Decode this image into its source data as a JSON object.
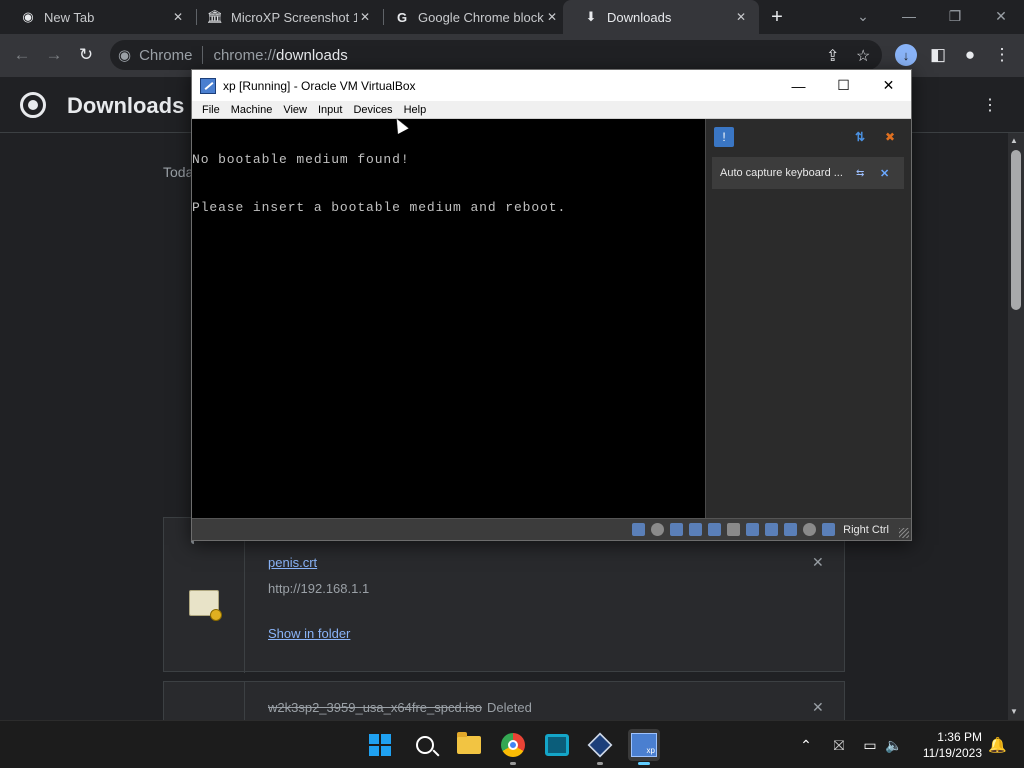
{
  "browser": {
    "tabs": [
      {
        "label": "New Tab",
        "icon": "chrome-icon",
        "active": false
      },
      {
        "label": "MicroXP Screenshot 1",
        "icon": "archive-icon",
        "active": false
      },
      {
        "label": "Google Chrome block",
        "icon": "google-icon",
        "active": false
      },
      {
        "label": "Downloads",
        "icon": "download-icon",
        "active": true
      }
    ],
    "omnibox": {
      "chip_label": "Chrome",
      "url_scheme": "chrome://",
      "url_host": "downloads"
    }
  },
  "downloads_page": {
    "title": "Downloads",
    "section_label": "Toda",
    "items": [
      {
        "file_name": "penis.crt",
        "source_url": "http://192.168.1.1",
        "action_label": "Show in folder"
      },
      {
        "file_name": "w2k3sp2_3959_usa_x64fre_spcd.iso",
        "status": "Deleted"
      }
    ]
  },
  "virtualbox": {
    "title": "xp [Running] - Oracle VM VirtualBox",
    "menu": [
      "File",
      "Machine",
      "View",
      "Input",
      "Devices",
      "Help"
    ],
    "console_lines": [
      "No bootable medium found!",
      "Please insert a bootable medium and reboot."
    ],
    "notification_text": "Auto capture keyboard ...",
    "host_key_label": "Right Ctrl"
  },
  "taskbar": {
    "time": "1:36 PM",
    "date": "11/19/2023"
  },
  "colors": {
    "chrome_dark_bg": "#202124",
    "chrome_toolbar": "#35363a",
    "link_blue": "#8ab4f8",
    "vbox_blue": "#4a7fd0",
    "win_accent": "#60cdff"
  }
}
